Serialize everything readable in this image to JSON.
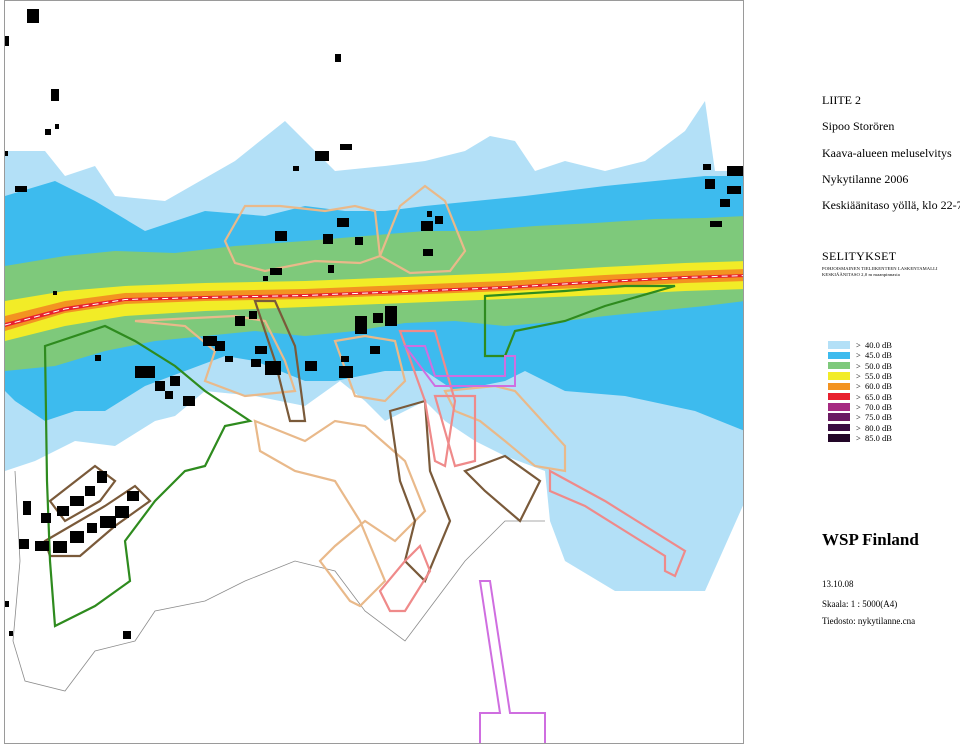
{
  "legend": {
    "title_lines": [
      "LIITE 2",
      "Sipoo Storören",
      "Kaava-alueen meluselvitys",
      "Nykytilanne 2006",
      "Keskiäänitaso yöllä, klo 22-7"
    ],
    "heading": "SELITYKSET",
    "model_line1": "POHJOISMAINEN TIELIIKENTEEN LASKENTAMALLI",
    "model_line2": "KESKIÄÄNITASO 2,0 m maanpinnasta",
    "items": [
      {
        "label": ">  40.0 dB",
        "color": "#b3e0f7"
      },
      {
        "label": ">  45.0 dB",
        "color": "#3dbbee"
      },
      {
        "label": ">  50.0 dB",
        "color": "#7ec97b"
      },
      {
        "label": ">  55.0 dB",
        "color": "#f2ec27"
      },
      {
        "label": ">  60.0 dB",
        "color": "#f39321"
      },
      {
        "label": ">  65.0 dB",
        "color": "#e8202f"
      },
      {
        "label": ">  70.0 dB",
        "color": "#a62a82"
      },
      {
        "label": ">  75.0 dB",
        "color": "#6a1a62"
      },
      {
        "label": ">  80.0 dB",
        "color": "#3a0c42"
      },
      {
        "label": ">  85.0 dB",
        "color": "#220628"
      }
    ],
    "company": "WSP Finland",
    "date": "13.10.08",
    "scale": "Skaala: 1 : 5000(A4)",
    "file": "Tiedosto: nykytilanne.cna"
  },
  "map_colors": {
    "noise_40": "#b3e0f7",
    "noise_45": "#3dbbee",
    "noise_50": "#7ec97b",
    "noise_55": "#f2ec27",
    "noise_60": "#f39321",
    "noise_65": "#e8202f",
    "building": "#000000",
    "plan_tan": "#e9b98a",
    "plan_brown": "#7a5a3a",
    "plan_green": "#2e8b1e",
    "plan_pink": "#ef8a8a",
    "plan_violet": "#cf6ee0",
    "shoreline": "#8c8c8c"
  }
}
